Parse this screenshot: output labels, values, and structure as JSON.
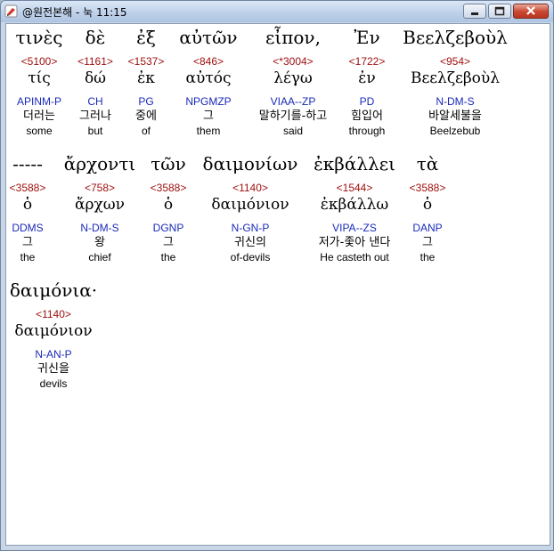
{
  "window": {
    "title": "@원전본해 - 눅 11:15"
  },
  "rows": [
    [
      {
        "greek": "τινὲς",
        "strong": "<5100>",
        "lemma": "τίς",
        "parse": "APINM-P",
        "korean": "더러는",
        "english": "some"
      },
      {
        "greek": "δὲ",
        "strong": "<1161>",
        "lemma": "δώ",
        "parse": "CH",
        "korean": "그러나",
        "english": "but"
      },
      {
        "greek": "ἐξ",
        "strong": "<1537>",
        "lemma": "ἐκ",
        "parse": "PG",
        "korean": "중에",
        "english": "of"
      },
      {
        "greek": "αὐτῶν",
        "strong": "<846>",
        "lemma": "αὐτός",
        "parse": "NPGMZP",
        "korean": "그",
        "english": "them"
      },
      {
        "greek": "εἶπον,",
        "strong": "<*3004>",
        "lemma": "λέγω",
        "parse": "VIAA--ZP",
        "korean": "말하기를-하고",
        "english": "said"
      },
      {
        "greek": "Ἐν",
        "strong": "<1722>",
        "lemma": "ἐν",
        "parse": "PD",
        "korean": "힘입어",
        "english": "through"
      },
      {
        "greek": "Βεελζεβοὺλ",
        "strong": "<954>",
        "lemma": "Βεελζεβοὺλ",
        "parse": "N-DM-S",
        "korean": "바알세불을",
        "english": "Beelzebub"
      }
    ],
    [
      {
        "greek": "-----",
        "strong": "<3588>",
        "lemma": "ὁ",
        "parse": "DDMS",
        "korean": "그",
        "english": "the"
      },
      {
        "greek": "ἄρχοντι",
        "strong": "<758>",
        "lemma": "ἄρχων",
        "parse": "N-DM-S",
        "korean": "왕",
        "english": "chief"
      },
      {
        "greek": "τῶν",
        "strong": "<3588>",
        "lemma": "ὁ",
        "parse": "DGNP",
        "korean": "그",
        "english": "the"
      },
      {
        "greek": "δαιμονίων",
        "strong": "<1140>",
        "lemma": "δαιμόνιον",
        "parse": "N-GN-P",
        "korean": "귀신의",
        "english": "of-devils"
      },
      {
        "greek": "ἐκβάλλει",
        "strong": "<1544>",
        "lemma": "ἐκβάλλω",
        "parse": "VIPA--ZS",
        "korean": "저가-좇아 낸다",
        "english": "He casteth out"
      },
      {
        "greek": "τὰ",
        "strong": "<3588>",
        "lemma": "ὁ",
        "parse": "DANP",
        "korean": "그",
        "english": "the"
      }
    ],
    [
      {
        "greek": "δαιμόνια·",
        "strong": "<1140>",
        "lemma": "δαιμόνιον",
        "parse": "N-AN-P",
        "korean": "귀신을",
        "english": "devils"
      }
    ]
  ]
}
